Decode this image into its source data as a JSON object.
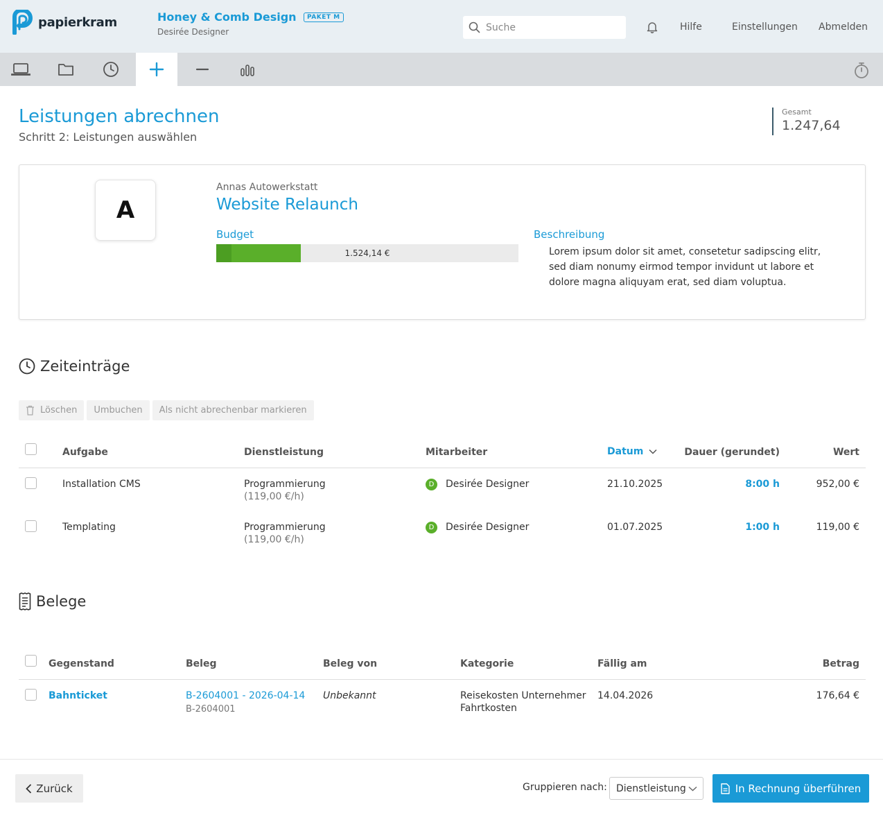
{
  "header": {
    "logo_text": "papierkram",
    "company_name": "Honey & Comb Design",
    "plan_badge": "PAKET M",
    "user_name": "Desirée Designer",
    "search_placeholder": "Suche",
    "links": {
      "help": "Hilfe",
      "settings": "Einstellungen",
      "logout": "Abmelden"
    }
  },
  "nav": {
    "tabs": [
      {
        "icon": "laptop-icon",
        "active": false
      },
      {
        "icon": "folder-icon",
        "active": false
      },
      {
        "icon": "clock-icon",
        "active": false
      },
      {
        "icon": "plus-icon",
        "active": true
      },
      {
        "icon": "minus-icon",
        "active": false
      },
      {
        "icon": "bar-chart-icon",
        "active": false
      }
    ],
    "right_icon": "stopwatch-icon"
  },
  "page": {
    "title": "Leistungen abrechnen",
    "subtitle": "Schritt 2: Leistungen auswählen",
    "total_label": "Gesamt",
    "total_value": "1.247,64"
  },
  "project_card": {
    "avatar_letter": "A",
    "client": "Annas Autowerkstatt",
    "project": "Website Relaunch",
    "budget_label": "Budget",
    "budget_value": "1.524,14 €",
    "budget_used_fraction": 0.28,
    "description_label": "Beschreibung",
    "description": "Lorem ipsum dolor sit amet, consetetur sadipscing elitr, sed diam nonumy eirmod tempor invidunt ut labore et dolore magna aliquyam erat, sed diam voluptua."
  },
  "time_entries": {
    "title": "Zeiteinträge",
    "actions": {
      "delete": "Löschen",
      "rebook": "Umbuchen",
      "mark_unbillable": "Als nicht abrechenbar markieren"
    },
    "columns": {
      "task": "Aufgabe",
      "service": "Dienstleistung",
      "employee": "Mitarbeiter",
      "date": "Datum",
      "duration": "Dauer (gerundet)",
      "value": "Wert"
    },
    "rows": [
      {
        "task": "Installation CMS",
        "service": "Programmierung",
        "rate": "(119,00 €/h)",
        "employee_initial": "D",
        "employee": "Desirée Designer",
        "date": "21.10.2025",
        "duration": "8:00 h",
        "value": "952,00 €"
      },
      {
        "task": "Templating",
        "service": "Programmierung",
        "rate": "(119,00 €/h)",
        "employee_initial": "D",
        "employee": "Desirée Designer",
        "date": "01.07.2025",
        "duration": "1:00 h",
        "value": "119,00 €"
      }
    ]
  },
  "receipts": {
    "title": "Belege",
    "columns": {
      "item": "Gegenstand",
      "receipt": "Beleg",
      "receipt_from": "Beleg von",
      "category": "Kategorie",
      "due": "Fällig am",
      "amount": "Betrag"
    },
    "rows": [
      {
        "item": "Bahnticket",
        "receipt": "B-2604001 - 2026-04-14",
        "receipt_no": "B-2604001",
        "receipt_from": "Unbekannt",
        "category_1": "Reisekosten Unternehmer",
        "category_2": "Fahrtkosten",
        "due": "14.04.2026",
        "amount": "176,64 €"
      }
    ]
  },
  "footer": {
    "back": "Zurück",
    "group_label": "Gruppieren nach:",
    "group_value": "Dienstleistung",
    "primary": "In Rechnung überführen"
  },
  "colors": {
    "accent": "#1a9ad6",
    "budget_green": "#5aaf2a",
    "header_bg": "#e9eff3",
    "nav_bg": "#d9dcdf"
  }
}
